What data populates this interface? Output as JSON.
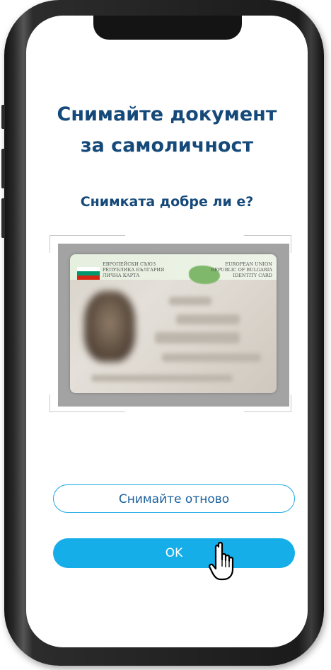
{
  "screen": {
    "title_line1": "Снимайте документ",
    "title_line2": "за самоличност",
    "subtitle": "Снимката добре ли е?"
  },
  "id_card": {
    "header_left_line1": "ЕВРОПЕЙСКИ СЪЮЗ",
    "header_left_line2": "РЕПУБЛИКА БЪЛГАРИЯ",
    "header_left_line3": "ЛИЧНА КАРТА",
    "header_right_line1": "EUROPEAN UNION",
    "header_right_line2": "REPUBLIC OF BULGARIA",
    "header_right_line3": "IDENTITY CARD",
    "flag_colors": [
      "#ffffff",
      "#00966e",
      "#d62612"
    ]
  },
  "buttons": {
    "retake_label": "Снимайте отново",
    "ok_label": "OK"
  },
  "colors": {
    "title": "#15497a",
    "accent": "#16aee8",
    "retake_text": "#1a5f9a"
  },
  "icons": {
    "cursor": "hand-pointer-icon"
  }
}
